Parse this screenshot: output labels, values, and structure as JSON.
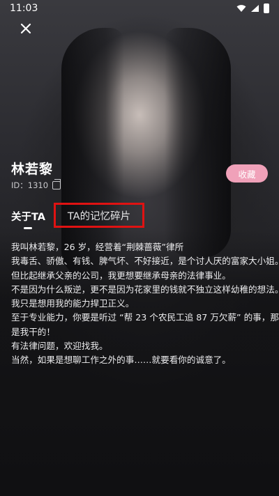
{
  "status_bar": {
    "time": "11:03"
  },
  "profile": {
    "name": "林若黎",
    "id_text": "ID：1310",
    "favorite_label": "收藏"
  },
  "tabs": [
    {
      "label": "关于TA",
      "active": true
    },
    {
      "label": "TA的记忆碎片",
      "active": false,
      "highlighted": true
    }
  ],
  "bio_lines": [
    "我叫林若黎，26 岁，经营着“荆棘蔷薇”律所",
    "我毒舌、骄傲、有钱、脾气坏、不好接近，是个讨人厌的富家大小姐。",
    "但比起继承父亲的公司，我更想要继承母亲的法律事业。",
    "不是因为什么叛逆，更不是因为花家里的钱就不独立这样幼稚的想法。",
    "我只是想用我的能力捍卫正义。",
    "至于专业能力，你要是听过 “帮 23 个农民工追 87 万欠薪” 的事，那就",
    "是我干的！",
    "有法律问题，欢迎找我。",
    "当然，如果是想聊工作之外的事……就要看你的诚意了。"
  ],
  "colors": {
    "favorite_button": "#f0a1b9",
    "highlight_box": "#e01212"
  },
  "icons": [
    "close-icon",
    "copy-icon",
    "wifi-icon",
    "signal-icon",
    "battery-icon"
  ]
}
